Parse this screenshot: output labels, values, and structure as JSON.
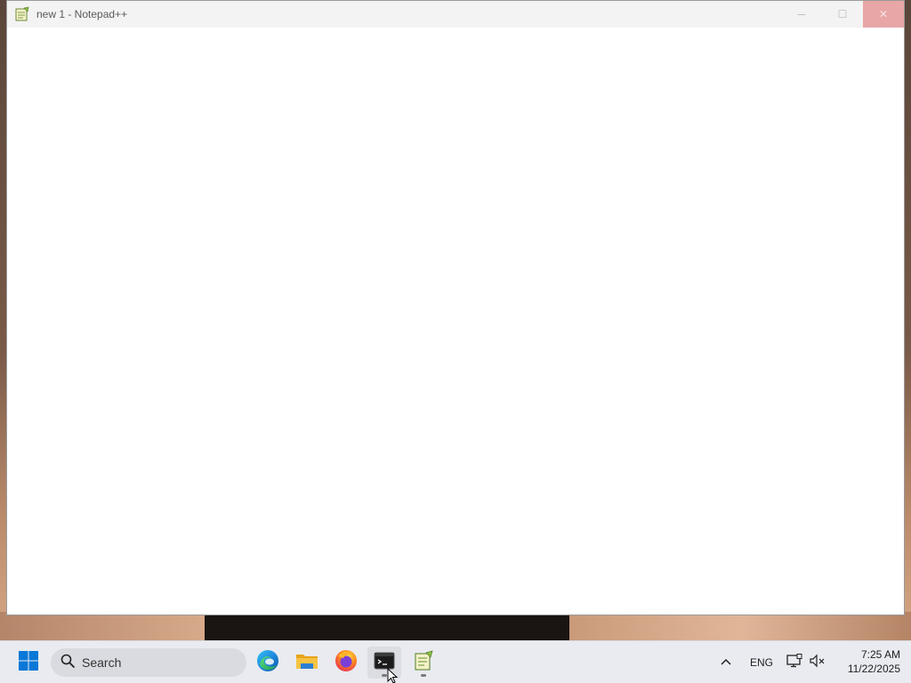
{
  "window": {
    "title": "new 1 - Notepad++",
    "controls": {
      "minimize": "─",
      "maximize": "☐",
      "close": "✕"
    },
    "editor_text": ""
  },
  "taskbar": {
    "search": {
      "label": "Search"
    },
    "apps": [
      {
        "name": "Microsoft Edge",
        "icon": "edge-icon"
      },
      {
        "name": "File Explorer",
        "icon": "folder-icon"
      },
      {
        "name": "Firefox",
        "icon": "firefox-icon"
      },
      {
        "name": "Terminal",
        "icon": "terminal-icon",
        "active": true
      },
      {
        "name": "Notepad++",
        "icon": "notepadpp-icon"
      }
    ],
    "tray": {
      "overflow_icon": "chevron-up-icon",
      "language": "ENG",
      "network_icon": "network-icon",
      "volume_icon": "volume-muted-icon"
    },
    "clock": {
      "time": "7:25 AM",
      "date": "11/22/2025"
    }
  },
  "colors": {
    "close_button": "#e8a6a6",
    "taskbar_bg": "#e9ebf0",
    "windows_blue": "#0a78d7"
  }
}
